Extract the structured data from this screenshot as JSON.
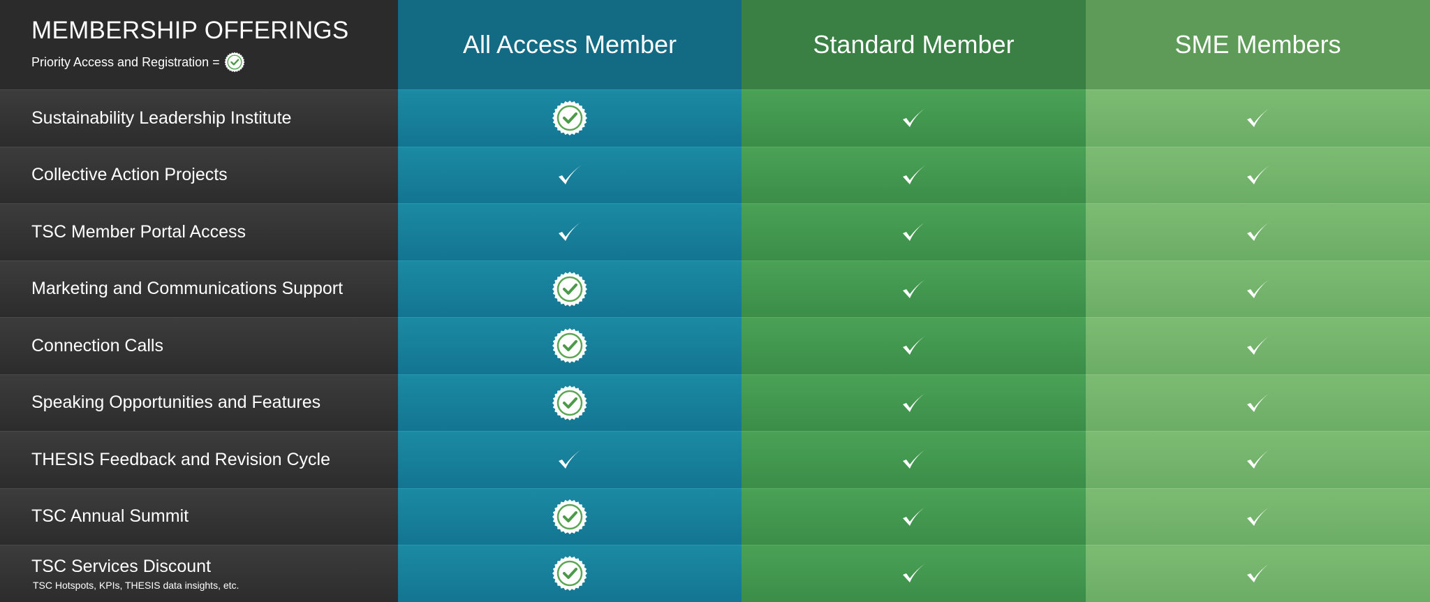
{
  "header": {
    "title": "MEMBERSHIP OFFERINGS",
    "subtitle": "Priority Access and Registration =",
    "subtitle_icon": "priority-badge-icon",
    "columns": [
      "All Access Member",
      "Standard Member",
      "SME Members"
    ]
  },
  "colors": {
    "all_access": "#137591",
    "standard": "#3b8d48",
    "sme": "#6cad66",
    "label_bg": "#2b2b2b"
  },
  "rows": [
    {
      "label": "Sustainability Leadership Institute",
      "note": "",
      "all_access": "priority-badge-icon",
      "standard": "check-icon",
      "sme": "check-icon"
    },
    {
      "label": "Collective Action Projects",
      "note": "",
      "all_access": "check-icon",
      "standard": "check-icon",
      "sme": "check-icon"
    },
    {
      "label": "TSC Member Portal Access",
      "note": "",
      "all_access": "check-icon",
      "standard": "check-icon",
      "sme": "check-icon"
    },
    {
      "label": "Marketing and Communications Support",
      "note": "",
      "all_access": "priority-badge-icon",
      "standard": "check-icon",
      "sme": "check-icon"
    },
    {
      "label": "Connection Calls",
      "note": "",
      "all_access": "priority-badge-icon",
      "standard": "check-icon",
      "sme": "check-icon"
    },
    {
      "label": "Speaking Opportunities and Features",
      "note": "",
      "all_access": "priority-badge-icon",
      "standard": "check-icon",
      "sme": "check-icon"
    },
    {
      "label": "THESIS Feedback and Revision Cycle",
      "note": "",
      "all_access": "check-icon",
      "standard": "check-icon",
      "sme": "check-icon"
    },
    {
      "label": "TSC Annual Summit",
      "note": "",
      "all_access": "priority-badge-icon",
      "standard": "check-icon",
      "sme": "check-icon"
    },
    {
      "label": "TSC Services Discount",
      "note": "TSC Hotspots, KPIs, THESIS data insights, etc.",
      "all_access": "priority-badge-icon",
      "standard": "check-icon",
      "sme": "check-icon"
    }
  ]
}
